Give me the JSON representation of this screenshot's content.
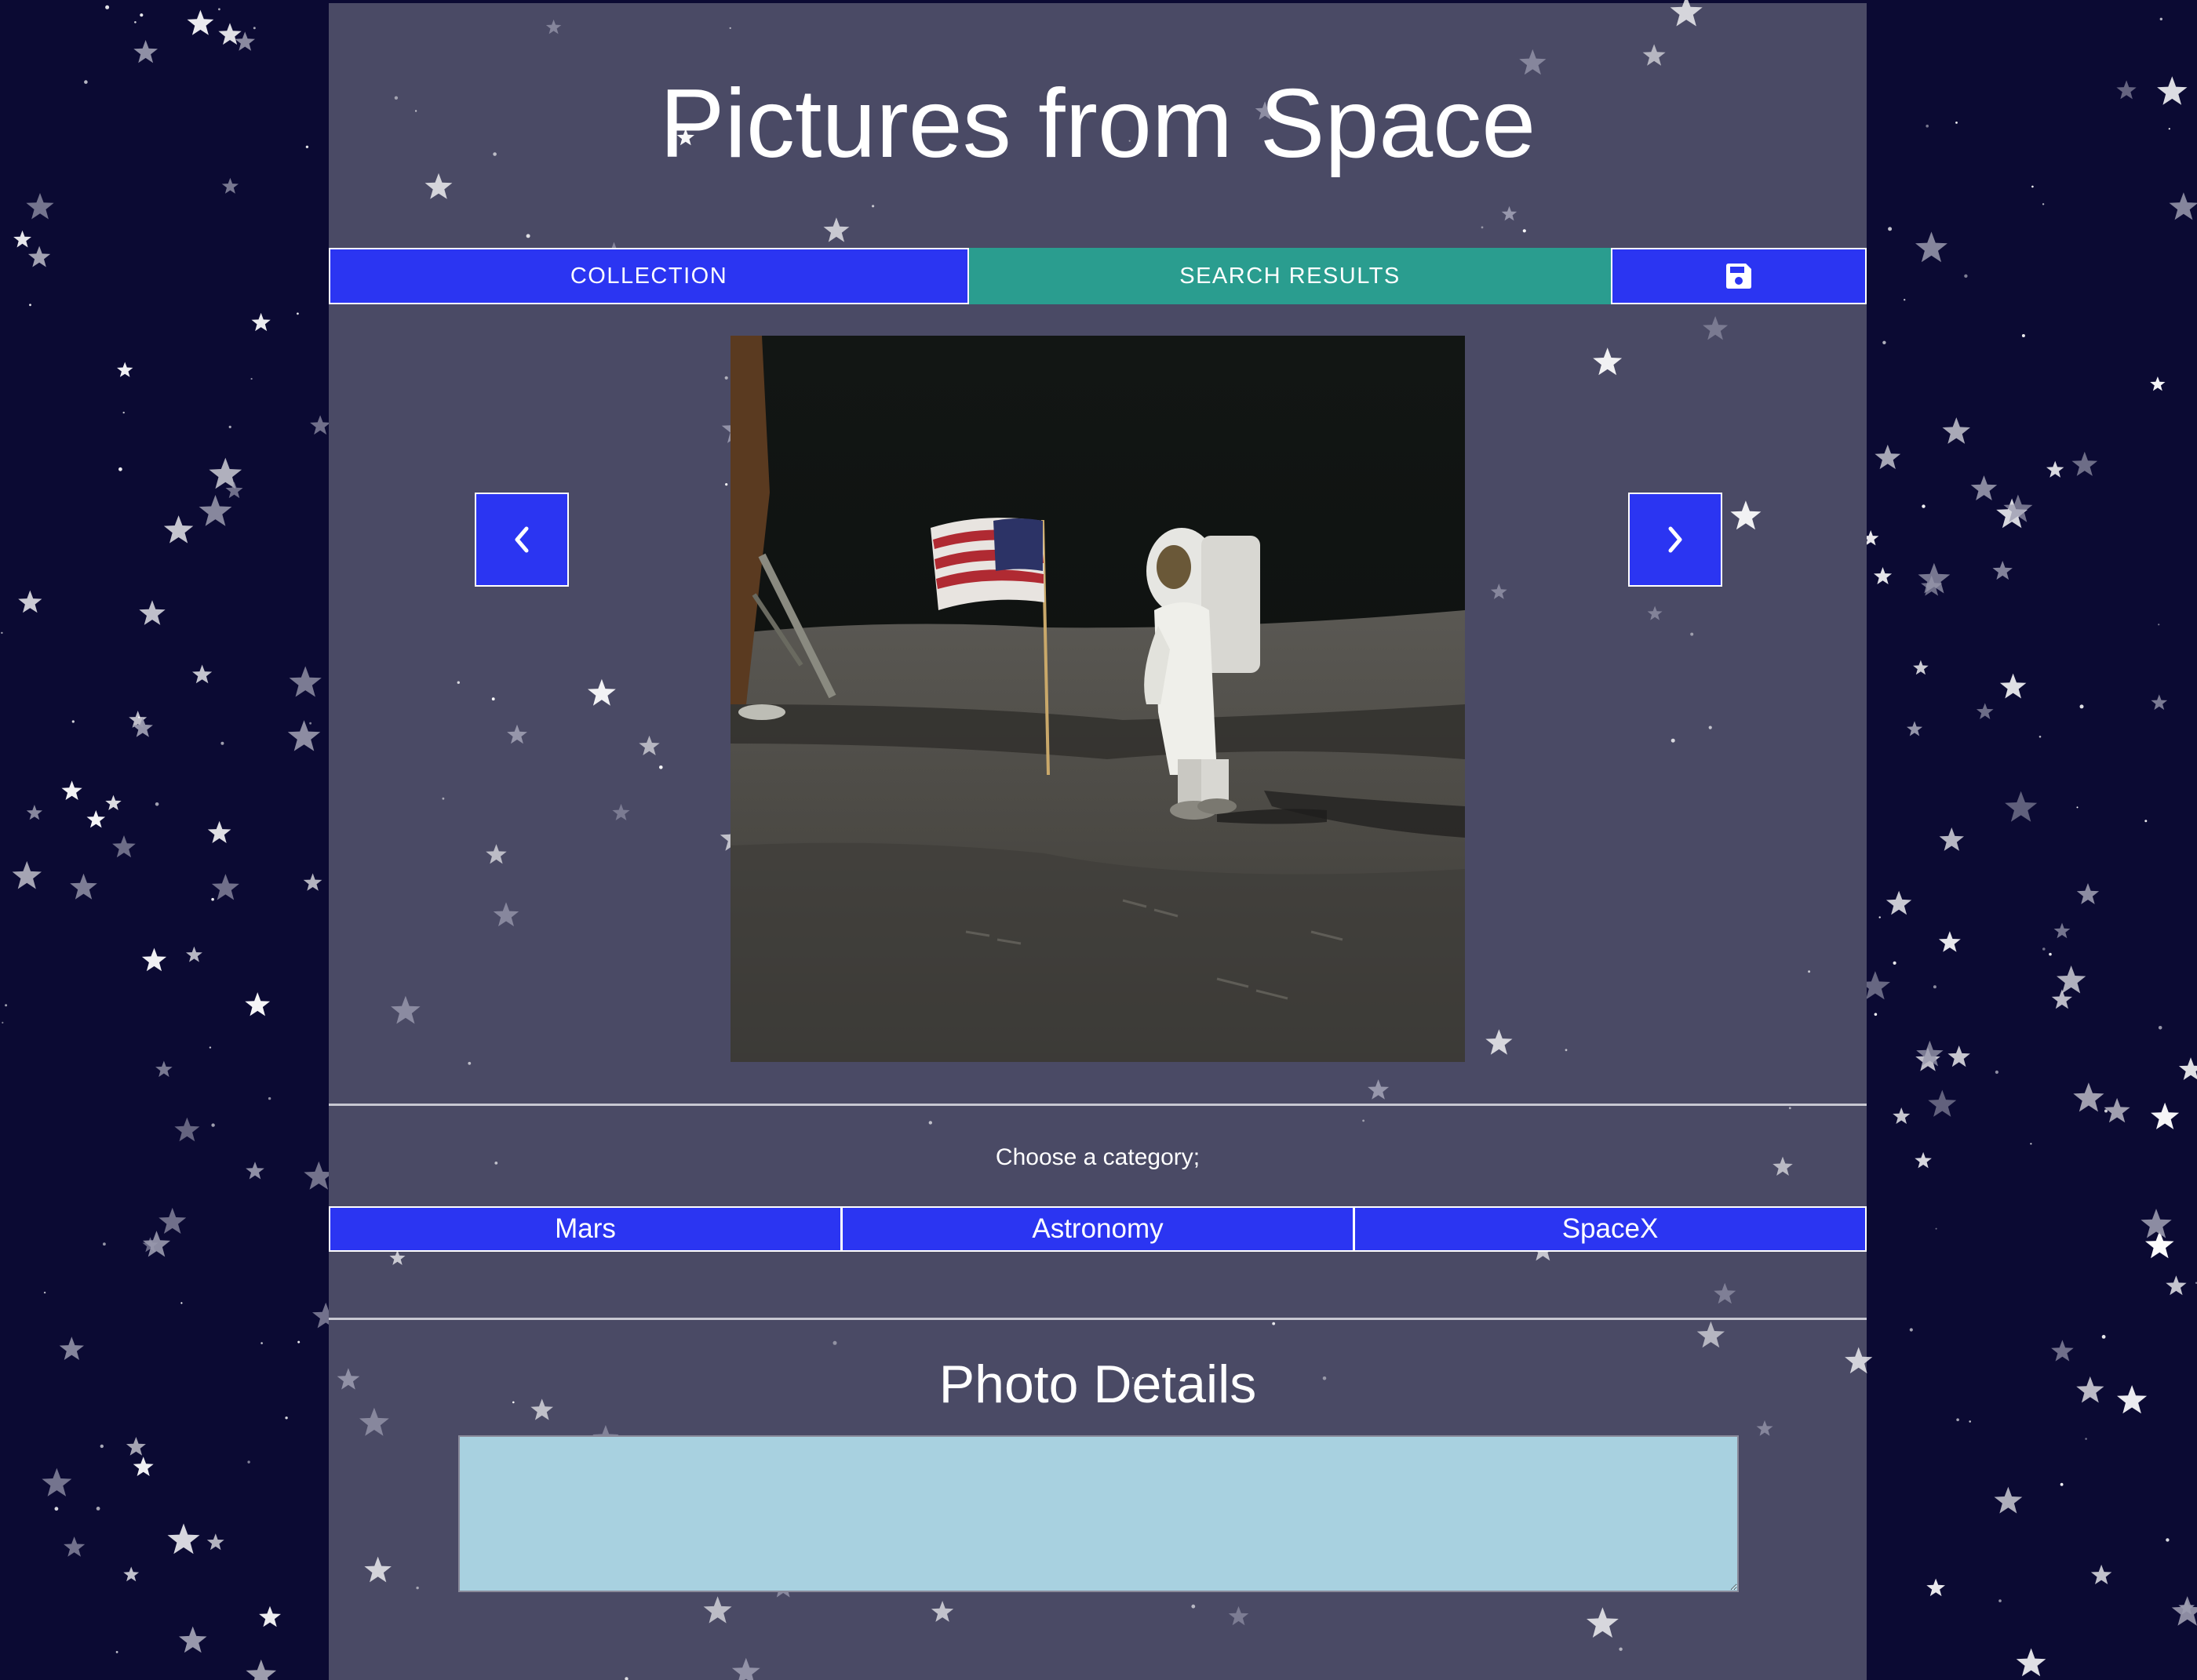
{
  "header": {
    "title": "Pictures from Space"
  },
  "tabs": {
    "collection_label": "COLLECTION",
    "search_results_label": "SEARCH RESULTS",
    "save_icon": "floppy-disk-icon"
  },
  "carousel": {
    "prev_icon": "chevron-left-icon",
    "next_icon": "chevron-right-icon",
    "photo_subject": "astronaut-with-flag-on-moon"
  },
  "categories": {
    "label": "Choose a category;",
    "items": [
      "Mars",
      "Astronomy",
      "SpaceX"
    ]
  },
  "details": {
    "title": "Photo Details",
    "value": ""
  },
  "colors": {
    "background": "#0b0a33",
    "panel": "#4a4a65",
    "button_blue": "#2b35f2",
    "active_tab_teal": "#2a9d8f",
    "details_box": "#a8d1e0"
  }
}
